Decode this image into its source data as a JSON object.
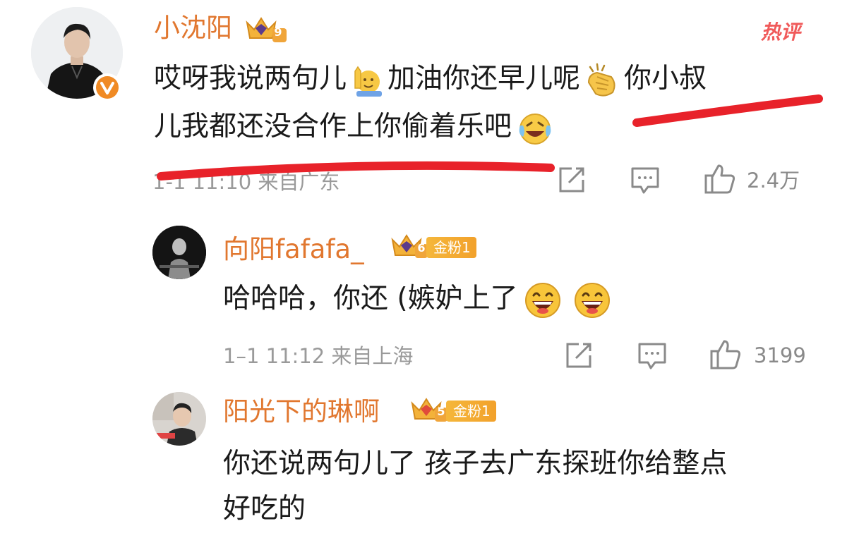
{
  "main_comment": {
    "author": "小沈阳",
    "level_badge": "9",
    "hot_label": "热评",
    "line1": {
      "part1": "哎呀我说两句儿",
      "part2": "加油你还早儿呢",
      "part3": "你小叔"
    },
    "line2": "儿我都还没合作上你偷着乐吧",
    "meta": "1-1 11:10 来自广东",
    "likes": "2.4万",
    "verified_color": "#f08a24"
  },
  "replies": [
    {
      "author": "向阳fafafa_",
      "level_badge": "6",
      "fan_badge": "金粉1",
      "text": "哈哈哈，你还 (嫉妒上了",
      "meta": "1–1 11:12 来自上海",
      "likes": "3199"
    },
    {
      "author": "阳光下的琳啊",
      "level_badge": "5",
      "fan_badge": "金粉1",
      "line1": "你还说两句儿了 孩子去广东探班你给整点",
      "line2": "好吃的"
    }
  ],
  "colors": {
    "name": "#e1772f",
    "annotation": "#e8222a",
    "meta": "#9a9a9a"
  }
}
